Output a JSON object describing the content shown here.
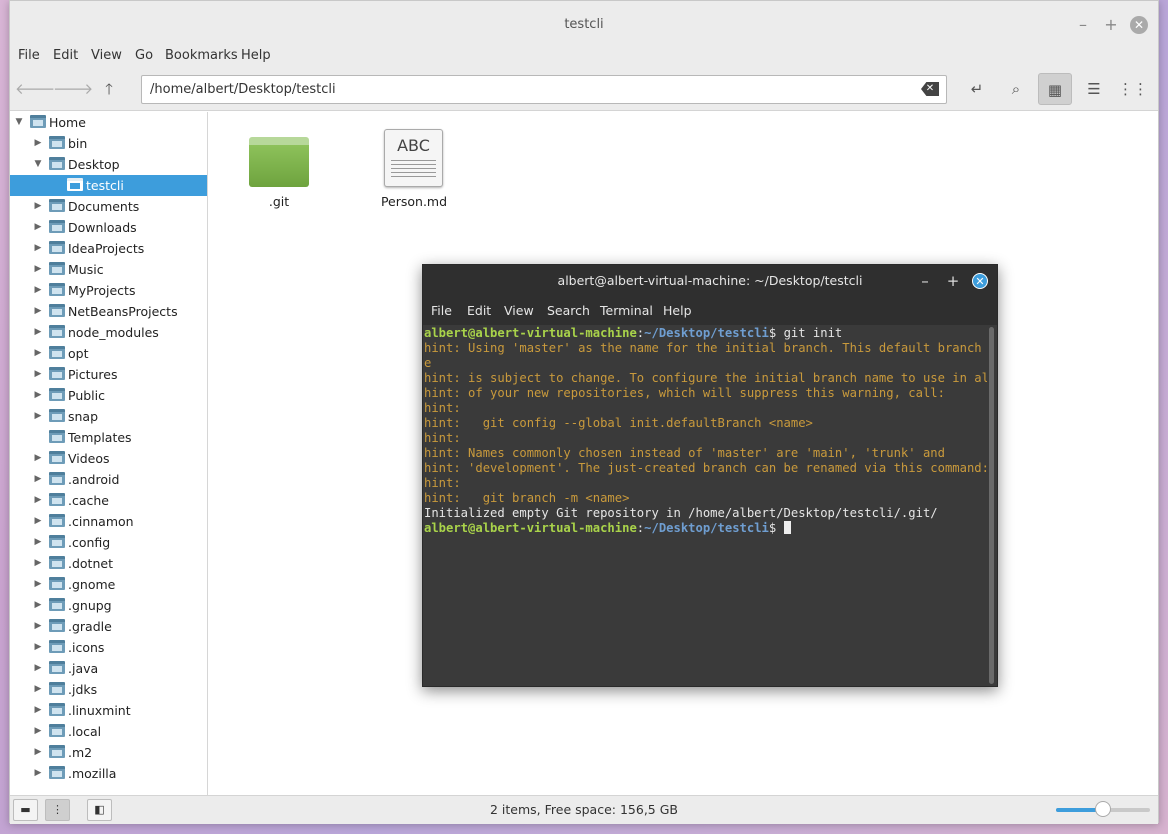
{
  "window": {
    "title": "testcli"
  },
  "menu": [
    "File",
    "Edit",
    "View",
    "Go",
    "Bookmarks",
    "Help"
  ],
  "path": "/home/albert/Desktop/testcli",
  "sidebar": {
    "items": [
      {
        "label": "Home",
        "level": 0,
        "expanded": true,
        "icon": "home-folder-icon"
      },
      {
        "label": "bin",
        "level": 1
      },
      {
        "label": "Desktop",
        "level": 1,
        "expanded": true
      },
      {
        "label": "testcli",
        "level": 2,
        "selected": true
      },
      {
        "label": "Documents",
        "level": 1
      },
      {
        "label": "Downloads",
        "level": 1
      },
      {
        "label": "IdeaProjects",
        "level": 1
      },
      {
        "label": "Music",
        "level": 1
      },
      {
        "label": "MyProjects",
        "level": 1
      },
      {
        "label": "NetBeansProjects",
        "level": 1
      },
      {
        "label": "node_modules",
        "level": 1
      },
      {
        "label": "opt",
        "level": 1
      },
      {
        "label": "Pictures",
        "level": 1
      },
      {
        "label": "Public",
        "level": 1
      },
      {
        "label": "snap",
        "level": 1
      },
      {
        "label": "Templates",
        "level": 1,
        "noarrow": true
      },
      {
        "label": "Videos",
        "level": 1
      },
      {
        "label": ".android",
        "level": 1
      },
      {
        "label": ".cache",
        "level": 1
      },
      {
        "label": ".cinnamon",
        "level": 1
      },
      {
        "label": ".config",
        "level": 1
      },
      {
        "label": ".dotnet",
        "level": 1
      },
      {
        "label": ".gnome",
        "level": 1
      },
      {
        "label": ".gnupg",
        "level": 1
      },
      {
        "label": ".gradle",
        "level": 1
      },
      {
        "label": ".icons",
        "level": 1
      },
      {
        "label": ".java",
        "level": 1
      },
      {
        "label": ".jdks",
        "level": 1
      },
      {
        "label": ".linuxmint",
        "level": 1
      },
      {
        "label": ".local",
        "level": 1
      },
      {
        "label": ".m2",
        "level": 1
      },
      {
        "label": ".mozilla",
        "level": 1
      }
    ]
  },
  "files": [
    {
      "name": ".git",
      "type": "folder"
    },
    {
      "name": "Person.md",
      "type": "document",
      "thumb_text": "ABC"
    }
  ],
  "status": {
    "text": "2 items, Free space: 156,5 GB",
    "zoom_fraction": 0.5
  },
  "terminal": {
    "title": "albert@albert-virtual-machine: ~/Desktop/testcli",
    "menu": [
      "File",
      "Edit",
      "View",
      "Search",
      "Terminal",
      "Help"
    ],
    "lines": [
      {
        "kind": "prompt",
        "user": "albert@albert-virtual-machine",
        "sep": ":",
        "path": "~/Desktop/testcli",
        "cmd": "$ git init"
      },
      {
        "kind": "hint",
        "text": "hint: Using 'master' as the name for the initial branch. This default branch nam"
      },
      {
        "kind": "hint",
        "text": "e"
      },
      {
        "kind": "hint",
        "text": "hint: is subject to change. To configure the initial branch name to use in all"
      },
      {
        "kind": "hint",
        "text": "hint: of your new repositories, which will suppress this warning, call:"
      },
      {
        "kind": "hint",
        "text": "hint:"
      },
      {
        "kind": "hint",
        "text": "hint:   git config --global init.defaultBranch <name>"
      },
      {
        "kind": "hint",
        "text": "hint:"
      },
      {
        "kind": "hint",
        "text": "hint: Names commonly chosen instead of 'master' are 'main', 'trunk' and"
      },
      {
        "kind": "hint",
        "text": "hint: 'development'. The just-created branch can be renamed via this command:"
      },
      {
        "kind": "hint",
        "text": "hint:"
      },
      {
        "kind": "hint",
        "text": "hint:   git branch -m <name>"
      },
      {
        "kind": "plain",
        "text": "Initialized empty Git repository in /home/albert/Desktop/testcli/.git/"
      },
      {
        "kind": "prompt",
        "user": "albert@albert-virtual-machine",
        "sep": ":",
        "path": "~/Desktop/testcli",
        "cmd": "$ ",
        "cursor": true
      }
    ]
  }
}
